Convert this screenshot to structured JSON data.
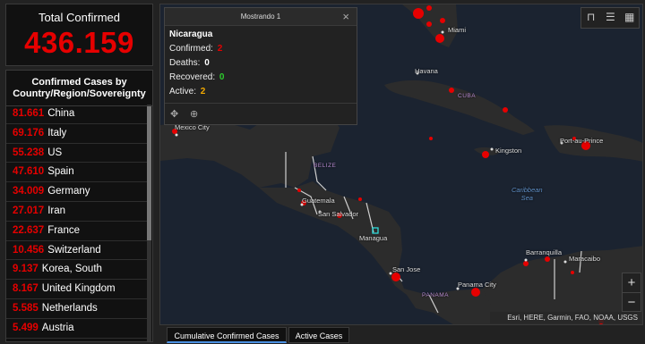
{
  "total": {
    "title": "Total Confirmed",
    "value": "436.159"
  },
  "list": {
    "header_line1": "Confirmed Cases by",
    "header_line2": "Country/Region/Sovereignty",
    "items": [
      {
        "num": "81.661",
        "name": "China"
      },
      {
        "num": "69.176",
        "name": "Italy"
      },
      {
        "num": "55.238",
        "name": "US"
      },
      {
        "num": "47.610",
        "name": "Spain"
      },
      {
        "num": "34.009",
        "name": "Germany"
      },
      {
        "num": "27.017",
        "name": "Iran"
      },
      {
        "num": "22.637",
        "name": "France"
      },
      {
        "num": "10.456",
        "name": "Switzerland"
      },
      {
        "num": "9.137",
        "name": "Korea, South"
      },
      {
        "num": "8.167",
        "name": "United Kingdom"
      },
      {
        "num": "5.585",
        "name": "Netherlands"
      },
      {
        "num": "5.499",
        "name": "Austria"
      }
    ]
  },
  "popup": {
    "header": "Mostrando 1",
    "close_icon": "×",
    "title": "Nicaragua",
    "confirmed_label": "Confirmed:",
    "confirmed_value": "2",
    "deaths_label": "Deaths:",
    "deaths_value": "0",
    "recovered_label": "Recovered:",
    "recovered_value": "0",
    "active_label": "Active:",
    "active_value": "2",
    "pan_icon": "✥",
    "zoom_icon": "⊕"
  },
  "map": {
    "labels": {
      "miami": "Miami",
      "havana": "Havana",
      "cuba": "CUBA",
      "mexico_city": "Mexico City",
      "kingston": "Kingston",
      "port_au_prince": "Port-au-Prince",
      "belize": "BELIZE",
      "caribbean_sea_1": "Caribbean",
      "caribbean_sea_2": "Sea",
      "guatemala": "Guatemala",
      "san_salvador": "San Salvador",
      "managua": "Managua",
      "san_jose": "San Jose",
      "panama": "PANAMA",
      "panama_city": "Panama City",
      "barranquilla": "Barranquilla",
      "maracaibo": "Maracaibo"
    },
    "tools": {
      "bookmark_icon": "⊓",
      "list_icon": "☰",
      "qr_icon": "▦"
    },
    "zoom_in": "+",
    "zoom_out": "−",
    "attribution": "Esri, HERE, Garmin, FAO, NOAA, USGS",
    "colors": {
      "ocean": "#1b2330",
      "land": "#2c2c2c",
      "case_marker": "#e60000"
    }
  },
  "tabs": {
    "cumulative": "Cumulative Confirmed Cases",
    "active": "Active Cases"
  }
}
